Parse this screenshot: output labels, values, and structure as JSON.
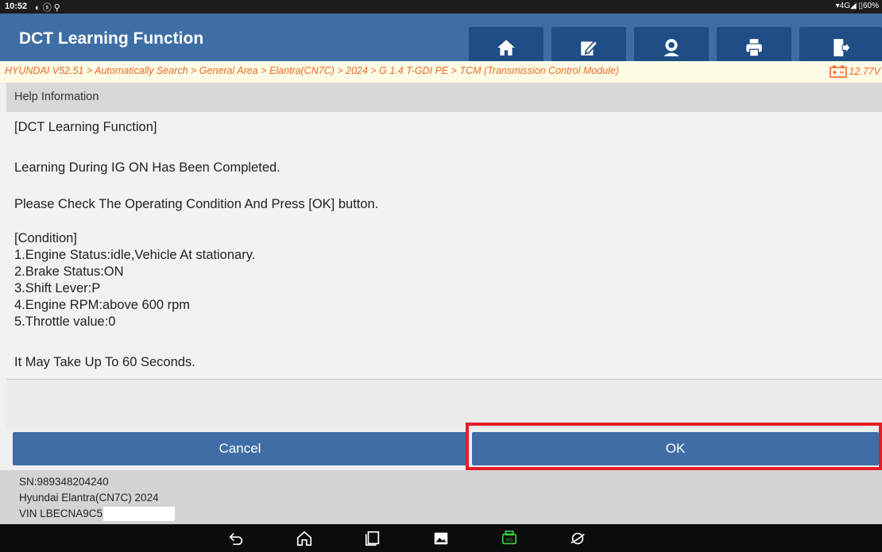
{
  "status_bar": {
    "time": "10:52",
    "icons_left": "◐ ⓢ ⚲",
    "right": "▾4G◢ ▯60%"
  },
  "header": {
    "title": "DCT Learning Function",
    "toolbar": [
      "home-icon",
      "edit-report-icon",
      "user-icon",
      "print-icon",
      "exit-icon"
    ]
  },
  "breadcrumb": {
    "path": "HYUNDAI V52.51 > Automatically Search > General Area > Elantra(CN7C) > 2024 > G 1.4 T-GDI PE > TCM (Transmission Control Module)",
    "voltage": "12.77V"
  },
  "help": {
    "label": "Help Information"
  },
  "content": {
    "heading": "[DCT Learning Function]",
    "line1": "Learning During IG ON Has Been Completed.",
    "line2": "Please Check The Operating Condition And Press [OK] button.",
    "condition_title": "[Condition]",
    "conditions": [
      "1.Engine Status:idle,Vehicle At stationary.",
      "2.Brake Status:ON",
      "3.Shift Lever:P",
      "4.Engine RPM:above 600 rpm",
      "5.Throttle value:0"
    ],
    "footer": "It May Take Up To 60 Seconds."
  },
  "buttons": {
    "cancel": "Cancel",
    "ok": "OK"
  },
  "vehicle_info": {
    "sn": "SN:989348204240",
    "model": "Hyundai Elantra(CN7C) 2024",
    "vin": "VIN LBECNA9C5"
  },
  "colors": {
    "header": "#3e6ea5",
    "toolbar_button": "#1f4d86",
    "breadcrumb_text": "#ef6a28",
    "highlight": "#e41e26"
  },
  "nav_bar": [
    "back-icon",
    "home-icon",
    "recents-icon",
    "gallery-icon",
    "vci-icon",
    "browser-icon"
  ]
}
